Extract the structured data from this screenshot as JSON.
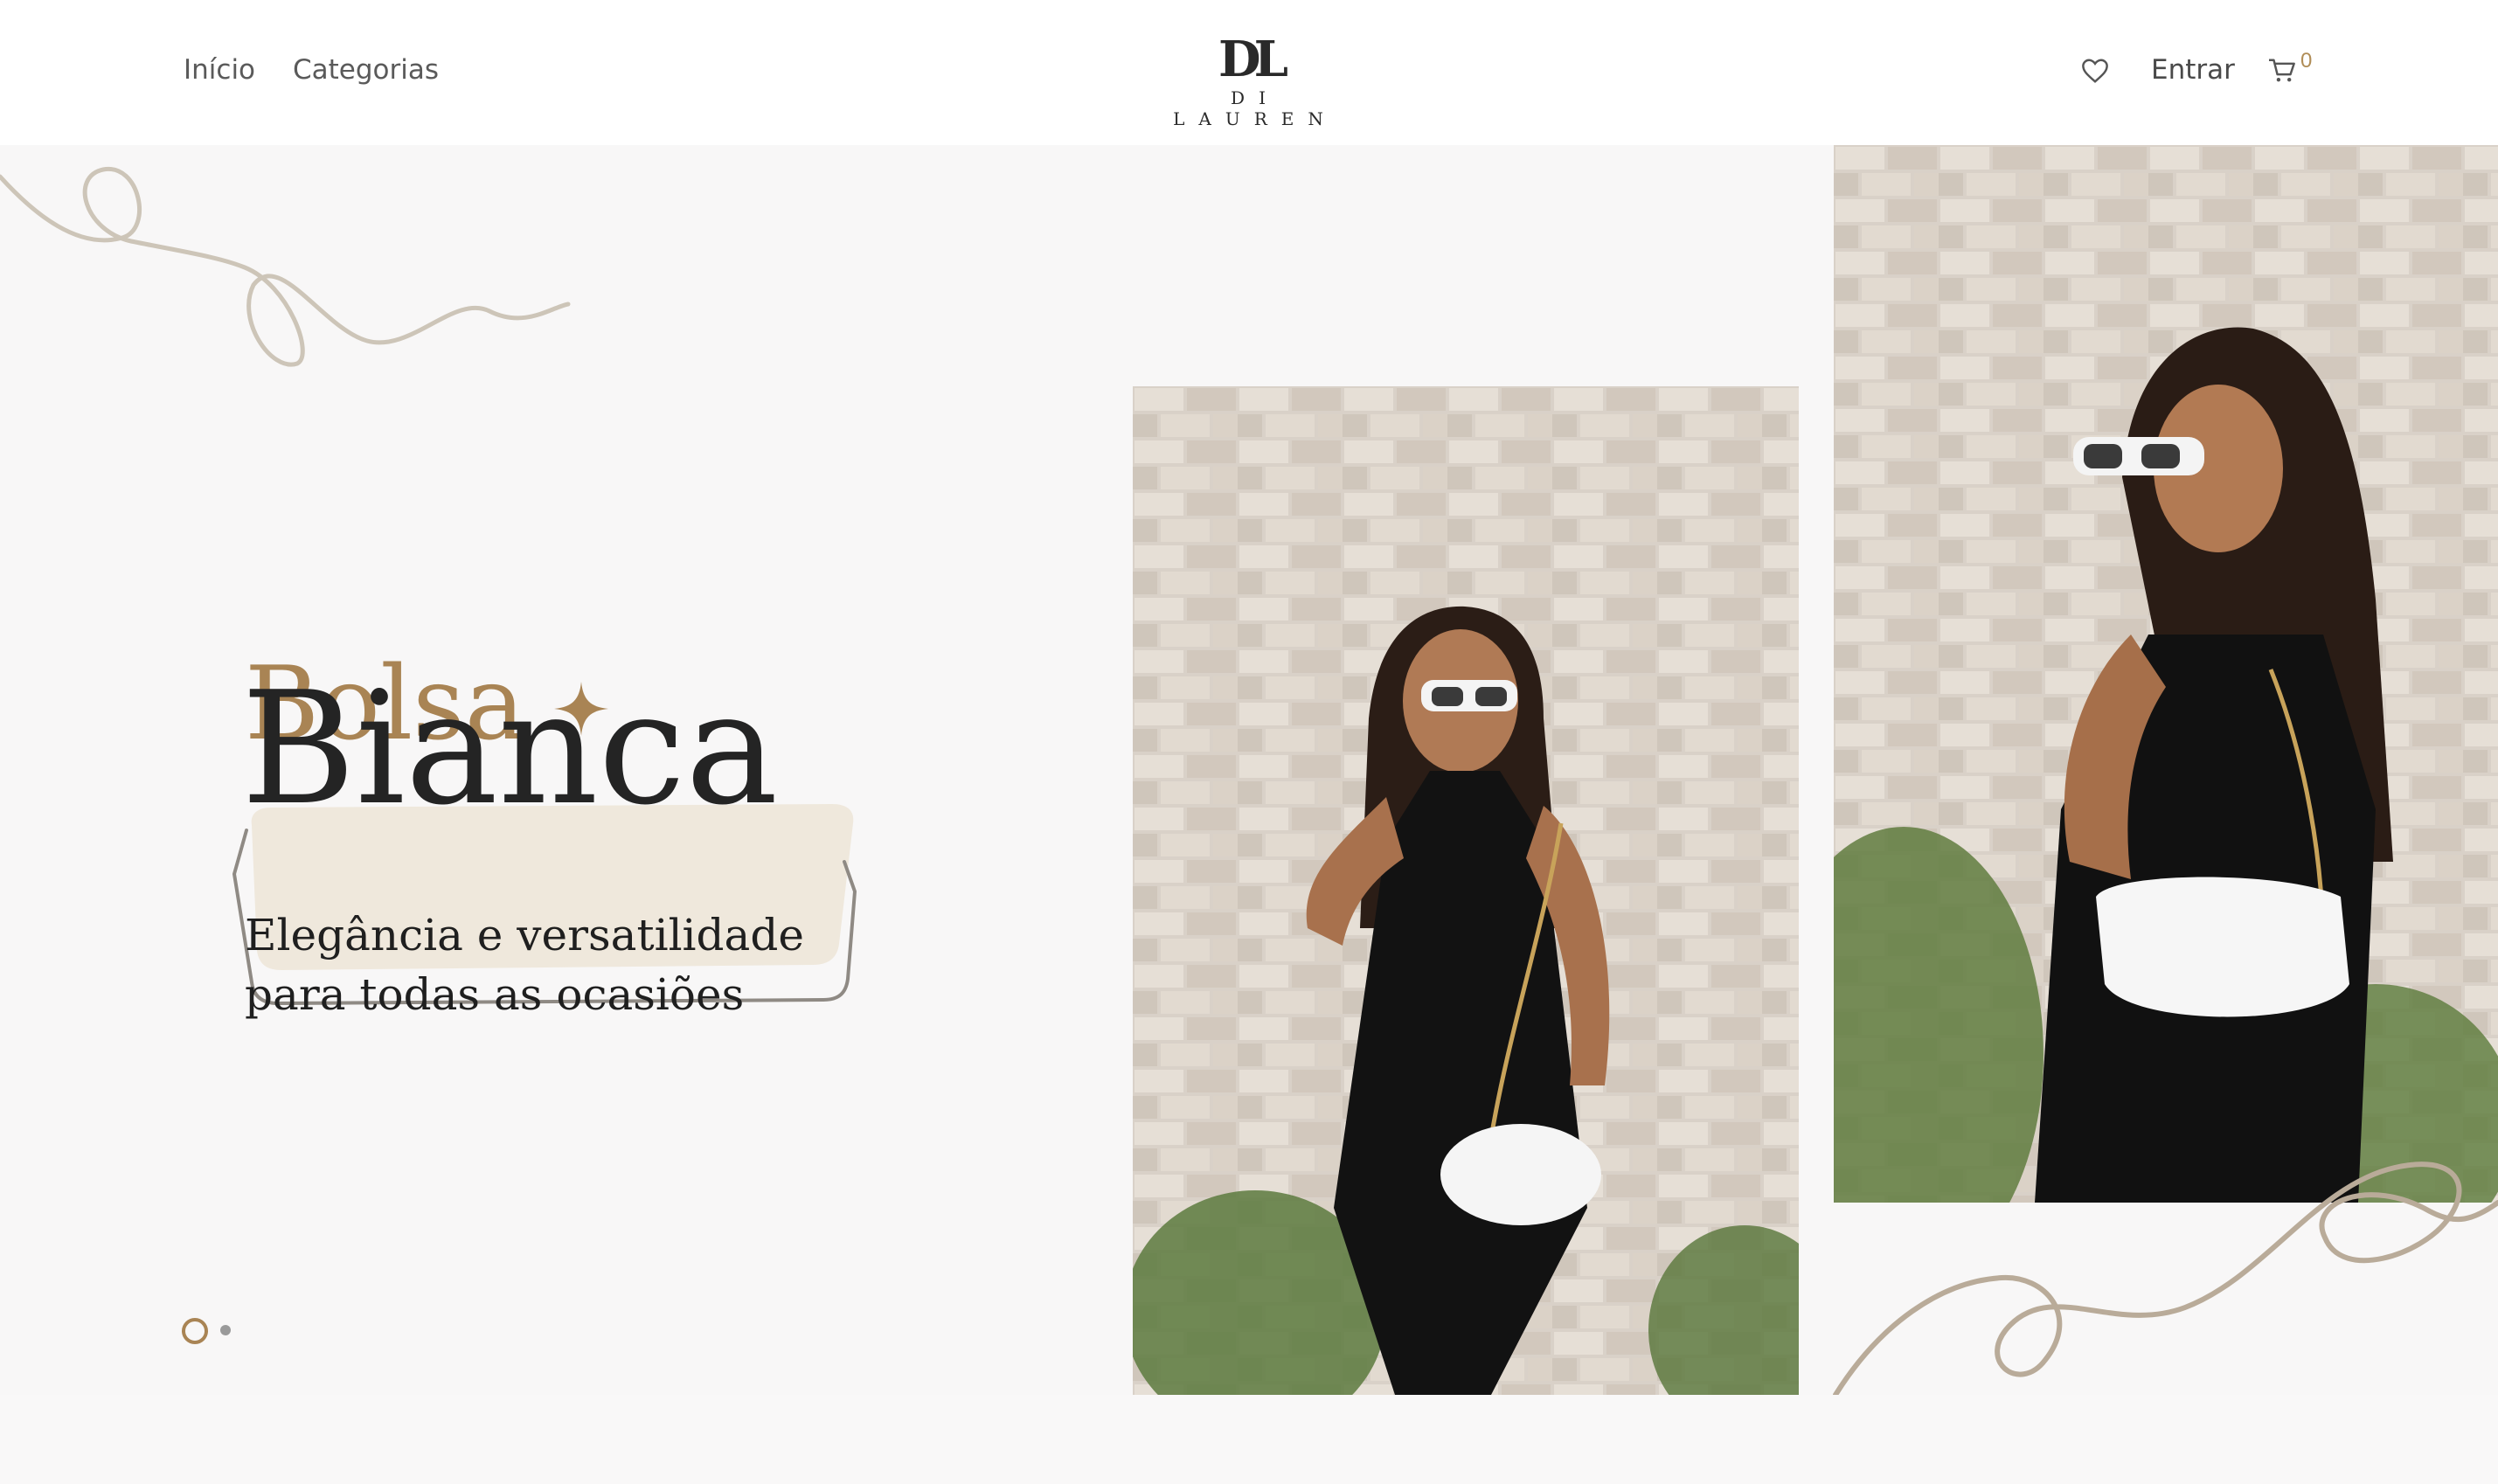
{
  "nav": {
    "home_label": "Início",
    "categories_label": "Categorias"
  },
  "logo": {
    "mark": "DL",
    "text": "DI LAUREN"
  },
  "header_actions": {
    "wishlist_icon": "heart-icon",
    "login_label": "Entrar",
    "cart_icon": "cart-icon",
    "cart_count": "0"
  },
  "hero": {
    "kicker": "Bolsa",
    "title": "Bianca",
    "tagline_line1": "Elegância e versatilidade",
    "tagline_line2": "para todas as ocasiões",
    "decor_icon": "sparkle-icon",
    "slides_total": 2,
    "active_slide": 1
  },
  "colors": {
    "accent": "#a98454",
    "title_highlight": "#efe8dc",
    "text_dark": "#242424",
    "hero_bg": "#f8f7f7",
    "squiggle": "#cfc7bb"
  }
}
